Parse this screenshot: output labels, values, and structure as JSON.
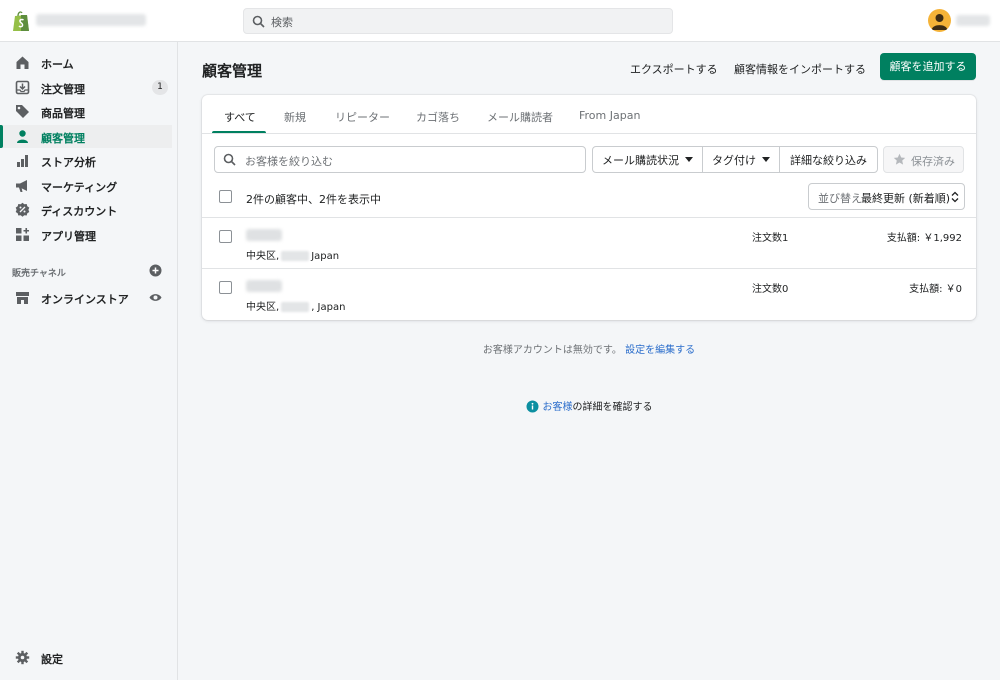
{
  "topbar": {
    "logo_icon": "shopify-bag-icon",
    "search_placeholder": "検索",
    "avatar_icon": "user-avatar-icon",
    "accent": "#008060"
  },
  "sidebar": {
    "items": [
      {
        "label": "ホーム",
        "icon": "home-icon"
      },
      {
        "label": "注文管理",
        "icon": "orders-inbox-icon",
        "badge": "1"
      },
      {
        "label": "商品管理",
        "icon": "tag-icon"
      },
      {
        "label": "顧客管理",
        "icon": "person-icon",
        "active": true
      },
      {
        "label": "ストア分析",
        "icon": "bar-chart-icon"
      },
      {
        "label": "マーケティング",
        "icon": "megaphone-icon"
      },
      {
        "label": "ディスカウント",
        "icon": "discount-icon"
      },
      {
        "label": "アプリ管理",
        "icon": "apps-grid-icon"
      }
    ],
    "channels_label": "販売チャネル",
    "online_store": "オンラインストア",
    "settings": "設定"
  },
  "header": {
    "title": "顧客管理",
    "export": "エクスポートする",
    "import": "顧客情報をインポートする",
    "add_customer": "顧客を追加する"
  },
  "tabs": [
    "すべて",
    "新規",
    "リピーター",
    "カゴ落ち",
    "メール購読者",
    "From Japan"
  ],
  "filters": {
    "search_placeholder": "お客様を絞り込む",
    "email_status": "メール購読状況",
    "tagged": "タグ付け",
    "more_filters": "詳細な絞り込み",
    "saved": "保存済み"
  },
  "list": {
    "count_text": "2件の顧客中、2件を表示中",
    "sort_label": "並び替え",
    "sort_value": "最終更新 (新着順)",
    "customers": [
      {
        "loc_prefix": "中央区,",
        "loc_suffix": "Japan",
        "orders": "注文数1",
        "spent": "支払額: ￥1,992"
      },
      {
        "loc_prefix": "中央区,",
        "loc_suffix": ", Japan",
        "orders": "注文数0",
        "spent": "支払額: ￥0"
      }
    ]
  },
  "footer": {
    "accounts_text": "お客様アカウントは無効です。",
    "edit_link": "設定を編集する",
    "learn_link": "お客様",
    "learn_text": "の詳細を確認する"
  }
}
